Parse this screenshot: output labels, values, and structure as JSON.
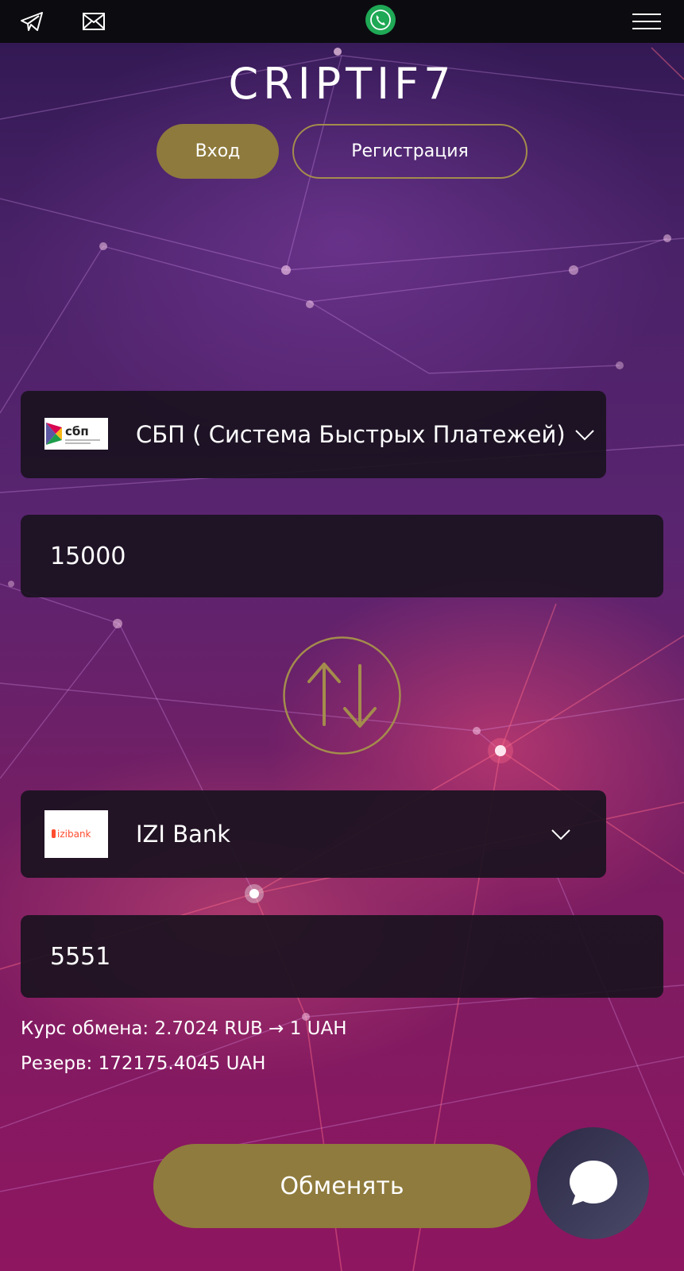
{
  "topbar": {
    "icons": [
      "telegram-icon",
      "mail-icon",
      "phone-icon",
      "menu-icon"
    ],
    "phone_color": "#1fa855"
  },
  "brand": {
    "logo_text": "CRIPTIF7"
  },
  "auth": {
    "login_label": "Вход",
    "register_label": "Регистрация"
  },
  "exchange": {
    "from": {
      "logo_text": "сбп",
      "method": "СБП ( Система Быстрых Платежей)",
      "amount": "15000"
    },
    "to": {
      "logo_text": "izibank",
      "method": "IZI Bank",
      "amount": "5551"
    },
    "rate_text": "Курс обмена: 2.7024 RUB → 1 UAH",
    "reserve_text": "Резерв: 172175.4045 UAH",
    "submit_label": "Обменять"
  },
  "colors": {
    "accent_gold": "#8e7a3c",
    "panel": "#1a1220",
    "topbar": "#0c0c10"
  }
}
